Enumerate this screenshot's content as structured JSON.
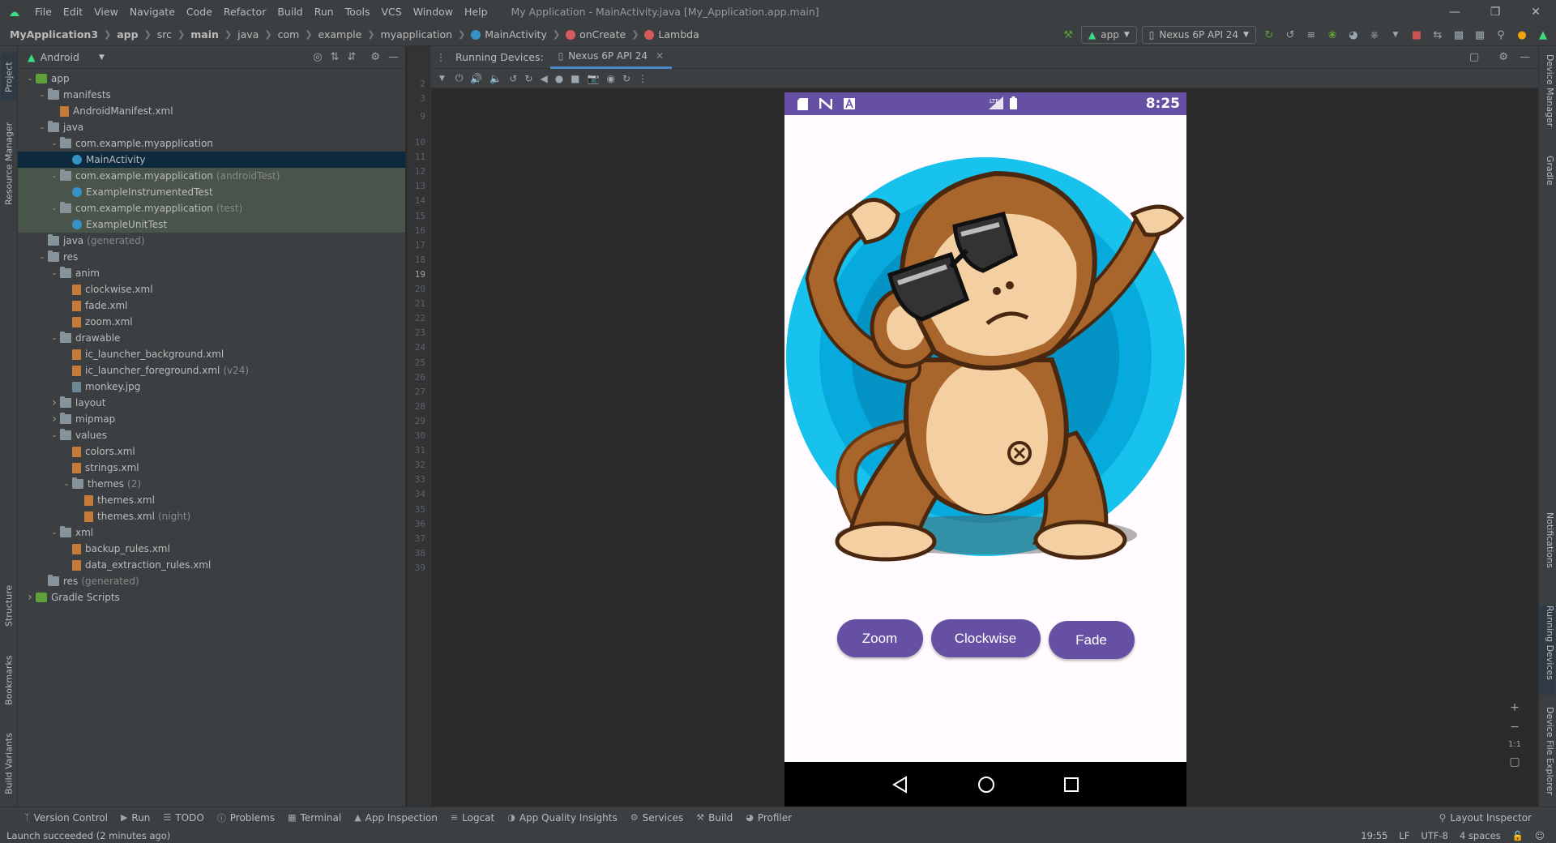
{
  "menu": {
    "items": [
      "File",
      "Edit",
      "View",
      "Navigate",
      "Code",
      "Refactor",
      "Build",
      "Run",
      "Tools",
      "VCS",
      "Window",
      "Help"
    ],
    "window_title": "My Application - MainActivity.java [My_Application.app.main]"
  },
  "breadcrumb": {
    "project": "MyApplication3",
    "path": [
      "app",
      "src",
      "main",
      "java",
      "com",
      "example",
      "myapplication"
    ],
    "class": "MainActivity",
    "method": "onCreate",
    "lambda": "Lambda"
  },
  "run_toolbar": {
    "config": "app",
    "device": "Nexus 6P API 24"
  },
  "left_stripe": {
    "project": "Project",
    "resource_manager": "Resource Manager",
    "structure": "Structure",
    "bookmarks": "Bookmarks",
    "build_variants": "Build Variants"
  },
  "right_stripe": {
    "device_manager": "Device Manager",
    "gradle": "Gradle",
    "notifications": "Notifications",
    "running_devices": "Running Devices",
    "device_file_explorer": "Device File Explorer"
  },
  "project_panel": {
    "view": "Android",
    "tree": [
      {
        "label": "app",
        "hint": "",
        "type": "module",
        "depth": 0,
        "expanded": true,
        "state": ""
      },
      {
        "label": "manifests",
        "hint": "",
        "type": "folder",
        "depth": 1,
        "expanded": true,
        "state": ""
      },
      {
        "label": "AndroidManifest.xml",
        "hint": "",
        "type": "xml",
        "depth": 2,
        "expanded": null,
        "state": ""
      },
      {
        "label": "java",
        "hint": "",
        "type": "folder",
        "depth": 1,
        "expanded": true,
        "state": ""
      },
      {
        "label": "com.example.myapplication",
        "hint": "",
        "type": "folder",
        "depth": 2,
        "expanded": true,
        "state": ""
      },
      {
        "label": "MainActivity",
        "hint": "",
        "type": "class",
        "depth": 3,
        "expanded": null,
        "state": "selected"
      },
      {
        "label": "com.example.myapplication",
        "hint": "(androidTest)",
        "type": "folder",
        "depth": 2,
        "expanded": true,
        "state": "test"
      },
      {
        "label": "ExampleInstrumentedTest",
        "hint": "",
        "type": "class",
        "depth": 3,
        "expanded": null,
        "state": "test"
      },
      {
        "label": "com.example.myapplication",
        "hint": "(test)",
        "type": "folder",
        "depth": 2,
        "expanded": true,
        "state": "test"
      },
      {
        "label": "ExampleUnitTest",
        "hint": "",
        "type": "class",
        "depth": 3,
        "expanded": null,
        "state": "test"
      },
      {
        "label": "java",
        "hint": "(generated)",
        "type": "folder",
        "depth": 1,
        "expanded": null,
        "state": ""
      },
      {
        "label": "res",
        "hint": "",
        "type": "folder",
        "depth": 1,
        "expanded": true,
        "state": ""
      },
      {
        "label": "anim",
        "hint": "",
        "type": "folder",
        "depth": 2,
        "expanded": true,
        "state": ""
      },
      {
        "label": "clockwise.xml",
        "hint": "",
        "type": "xml",
        "depth": 3,
        "expanded": null,
        "state": ""
      },
      {
        "label": "fade.xml",
        "hint": "",
        "type": "xml",
        "depth": 3,
        "expanded": null,
        "state": ""
      },
      {
        "label": "zoom.xml",
        "hint": "",
        "type": "xml",
        "depth": 3,
        "expanded": null,
        "state": ""
      },
      {
        "label": "drawable",
        "hint": "",
        "type": "folder",
        "depth": 2,
        "expanded": true,
        "state": ""
      },
      {
        "label": "ic_launcher_background.xml",
        "hint": "",
        "type": "xml",
        "depth": 3,
        "expanded": null,
        "state": ""
      },
      {
        "label": "ic_launcher_foreground.xml",
        "hint": "(v24)",
        "type": "xml",
        "depth": 3,
        "expanded": null,
        "state": ""
      },
      {
        "label": "monkey.jpg",
        "hint": "",
        "type": "img",
        "depth": 3,
        "expanded": null,
        "state": ""
      },
      {
        "label": "layout",
        "hint": "",
        "type": "folder",
        "depth": 2,
        "expanded": false,
        "state": ""
      },
      {
        "label": "mipmap",
        "hint": "",
        "type": "folder",
        "depth": 2,
        "expanded": false,
        "state": ""
      },
      {
        "label": "values",
        "hint": "",
        "type": "folder",
        "depth": 2,
        "expanded": true,
        "state": ""
      },
      {
        "label": "colors.xml",
        "hint": "",
        "type": "xml",
        "depth": 3,
        "expanded": null,
        "state": ""
      },
      {
        "label": "strings.xml",
        "hint": "",
        "type": "xml",
        "depth": 3,
        "expanded": null,
        "state": ""
      },
      {
        "label": "themes",
        "hint": "(2)",
        "type": "folder",
        "depth": 3,
        "expanded": true,
        "state": ""
      },
      {
        "label": "themes.xml",
        "hint": "",
        "type": "xml",
        "depth": 4,
        "expanded": null,
        "state": ""
      },
      {
        "label": "themes.xml",
        "hint": "(night)",
        "type": "xml",
        "depth": 4,
        "expanded": null,
        "state": ""
      },
      {
        "label": "xml",
        "hint": "",
        "type": "folder",
        "depth": 2,
        "expanded": true,
        "state": ""
      },
      {
        "label": "backup_rules.xml",
        "hint": "",
        "type": "xml",
        "depth": 3,
        "expanded": null,
        "state": ""
      },
      {
        "label": "data_extraction_rules.xml",
        "hint": "",
        "type": "xml",
        "depth": 3,
        "expanded": null,
        "state": ""
      },
      {
        "label": "res",
        "hint": "(generated)",
        "type": "folder",
        "depth": 1,
        "expanded": null,
        "state": ""
      },
      {
        "label": "Gradle Scripts",
        "hint": "",
        "type": "gradle",
        "depth": 0,
        "expanded": false,
        "state": ""
      }
    ]
  },
  "gutter": {
    "line_numbers": [
      "2",
      "3",
      "9",
      "10",
      "11",
      "12",
      "13",
      "14",
      "15",
      "16",
      "17",
      "18",
      "19",
      "20",
      "21",
      "22",
      "23",
      "24",
      "25",
      "26",
      "27",
      "28",
      "29",
      "30",
      "31",
      "32",
      "33",
      "34",
      "35",
      "36",
      "37",
      "38",
      "39"
    ],
    "current_line": "19"
  },
  "running_devices": {
    "title": "Running Devices:",
    "tab": "Nexus 6P API 24"
  },
  "emulator": {
    "clock": "8:25",
    "status_icons": [
      "sd-card-icon",
      "n-icon",
      "a-icon"
    ],
    "buttons": [
      "Zoom",
      "Clockwise",
      "Fade"
    ],
    "accent_color": "#6650a4"
  },
  "zoom_controls": {
    "one_to_one": "1:1"
  },
  "bottom_tools": [
    "Version Control",
    "Run",
    "TODO",
    "Problems",
    "Terminal",
    "App Inspection",
    "Logcat",
    "App Quality Insights",
    "Services",
    "Build",
    "Profiler"
  ],
  "layout_inspector": "Layout Inspector",
  "status": {
    "message": "Launch succeeded (2 minutes ago)",
    "position": "19:55",
    "line_sep": "LF",
    "encoding": "UTF-8",
    "indent": "4 spaces"
  }
}
